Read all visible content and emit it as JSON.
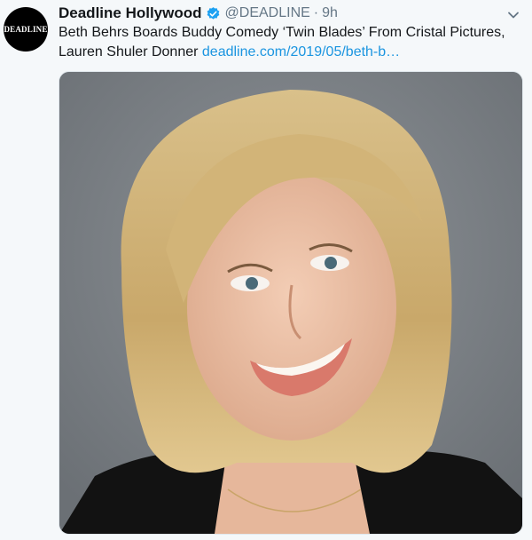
{
  "tweet": {
    "avatar_text": "DEADLINE",
    "display_name": "Deadline Hollywood",
    "handle": "@DEADLINE",
    "separator": "·",
    "time": "9h",
    "text_main": "Beth Behrs Boards Buddy Comedy  ‘Twin Blades’  From Cristal Pictures, Lauren Shuler Donner ",
    "link": "deadline.com/2019/05/beth-b…"
  },
  "icons": {
    "verified": "verified-badge-icon",
    "caret": "chevron-down-icon"
  },
  "colors": {
    "background": "#f5f8fa",
    "link": "#1b95e0",
    "verified": "#1da1f2",
    "muted": "#657786"
  }
}
